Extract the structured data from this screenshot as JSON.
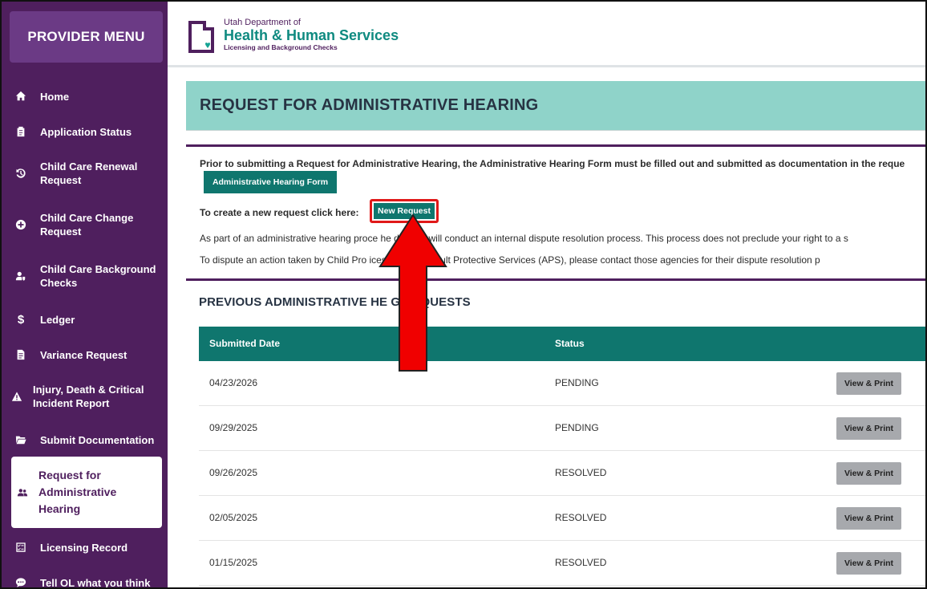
{
  "sidebar": {
    "header": "PROVIDER MENU",
    "items": [
      {
        "label": "Home",
        "icon": "home-icon"
      },
      {
        "label": "Application Status",
        "icon": "clipboard-icon"
      },
      {
        "label": "Child Care Renewal Request",
        "icon": "history-icon"
      },
      {
        "label": "Child Care Change Request",
        "icon": "plus-circle-icon"
      },
      {
        "label": "Child Care Background Checks",
        "icon": "user-shield-icon"
      },
      {
        "label": "Ledger",
        "icon": "dollar-icon"
      },
      {
        "label": "Variance Request",
        "icon": "document-icon"
      },
      {
        "label": "Injury, Death & Critical Incident Report",
        "icon": "warning-icon"
      },
      {
        "label": "Submit Documentation",
        "icon": "folder-icon"
      },
      {
        "label": "Request for Administrative Hearing",
        "icon": "people-icon"
      },
      {
        "label": "Licensing Record",
        "icon": "checklist-icon"
      },
      {
        "label": "Tell OL what you think",
        "icon": "chat-icon"
      }
    ]
  },
  "header": {
    "logo_small": "Utah Department of",
    "logo_big": "Health & Human Services",
    "logo_sub": "Licensing and Background Checks"
  },
  "page": {
    "title": "REQUEST FOR ADMINISTRATIVE HEARING",
    "intro": "Prior to submitting a Request for Administrative Hearing, the Administrative Hearing Form must be filled out and submitted as documentation in the reque",
    "form_button": "Administrative Hearing Form",
    "create_prompt": "To create a new request click here:",
    "new_request_button": "New Request",
    "line_process": "As part of an administrative hearing proce        he division will conduct an internal dispute resolution process. This process does not preclude your right to a s",
    "line_dispute": "To dispute an action taken by Child Pro          ices (CPS) or Adult Protective Services (APS), please contact those agencies for their dispute resolution p",
    "previous_title": "PREVIOUS ADMINISTRATIVE HE        G REQUESTS"
  },
  "table": {
    "columns": [
      "Submitted Date",
      "Status"
    ],
    "rows": [
      {
        "date": "04/23/2026",
        "status": "PENDING",
        "action": "View & Print"
      },
      {
        "date": "09/29/2025",
        "status": "PENDING",
        "action": "View & Print"
      },
      {
        "date": "09/26/2025",
        "status": "RESOLVED",
        "action": "View & Print"
      },
      {
        "date": "02/05/2025",
        "status": "RESOLVED",
        "action": "View & Print"
      },
      {
        "date": "01/15/2025",
        "status": "RESOLVED",
        "action": "View & Print"
      }
    ]
  },
  "colors": {
    "sidebar": "#4f1f5e",
    "teal": "#0f766e",
    "title_bar": "#8fd3c9",
    "highlight": "#e01919"
  }
}
